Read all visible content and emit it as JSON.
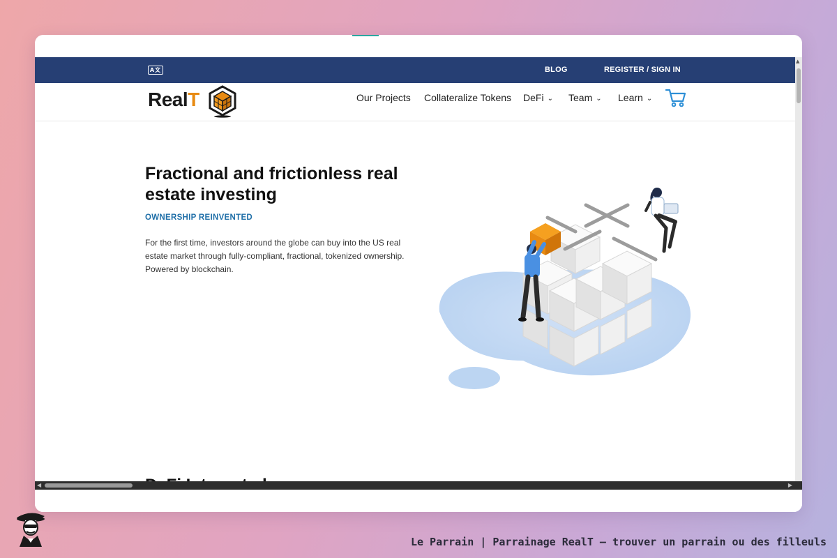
{
  "topbar": {
    "lang_icon": "A文",
    "blog": "BLOG",
    "register": "REGISTER / SIGN IN"
  },
  "logo": {
    "text_main": "Real",
    "text_accent": "T"
  },
  "nav": {
    "items": [
      {
        "label": "Our Projects",
        "dropdown": false
      },
      {
        "label": "Collateralize Tokens",
        "dropdown": false
      },
      {
        "label": "DeFi",
        "dropdown": true
      },
      {
        "label": "Team",
        "dropdown": true
      },
      {
        "label": "Learn",
        "dropdown": true
      }
    ],
    "cart_icon": "cart-icon"
  },
  "hero": {
    "title": "Fractional and frictionless real estate investing",
    "subtitle": "OWNERSHIP REINVENTED",
    "description": "For the first time, investors around the globe can buy into the US real estate market through fully-compliant, fractional, tokenized ownership. Powered by blockchain."
  },
  "next_section": {
    "title": "DeFi Integrated"
  },
  "footer": {
    "caption": "Le Parrain | Parrainage RealT — trouver un parrain ou des filleuls"
  },
  "colors": {
    "topbar": "#263f74",
    "accent_orange": "#e88a12",
    "subtitle_blue": "#1f6fa8",
    "cart_blue": "#2d8fd6"
  }
}
